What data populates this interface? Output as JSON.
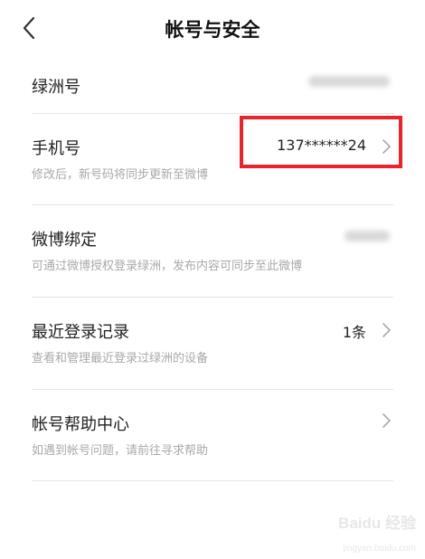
{
  "header": {
    "back_icon": "chevron-left-icon",
    "title": "帐号与安全"
  },
  "rows": [
    {
      "title": "绿洲号",
      "value_blurred": true
    },
    {
      "title": "手机号",
      "value": "137******24",
      "subtitle": "修改后，新号码将同步更新至微博"
    },
    {
      "title": "微博绑定",
      "value_blurred": true,
      "subtitle": "可通过微博授权登录绿洲，发布内容可同步至此微博"
    },
    {
      "title": "最近登录记录",
      "value": "1条",
      "subtitle": "查看和管理最近登录过绿洲的设备"
    },
    {
      "title": "帐号帮助中心",
      "subtitle": "如遇到帐号问题，请前往寻求帮助"
    }
  ],
  "colors": {
    "highlight": "#e8242c",
    "subtitle": "#a9a9a9",
    "divider": "#e6e6e6"
  },
  "watermark": {
    "logo": "Baidu 经验",
    "url": "jingyan.baidu.com"
  }
}
